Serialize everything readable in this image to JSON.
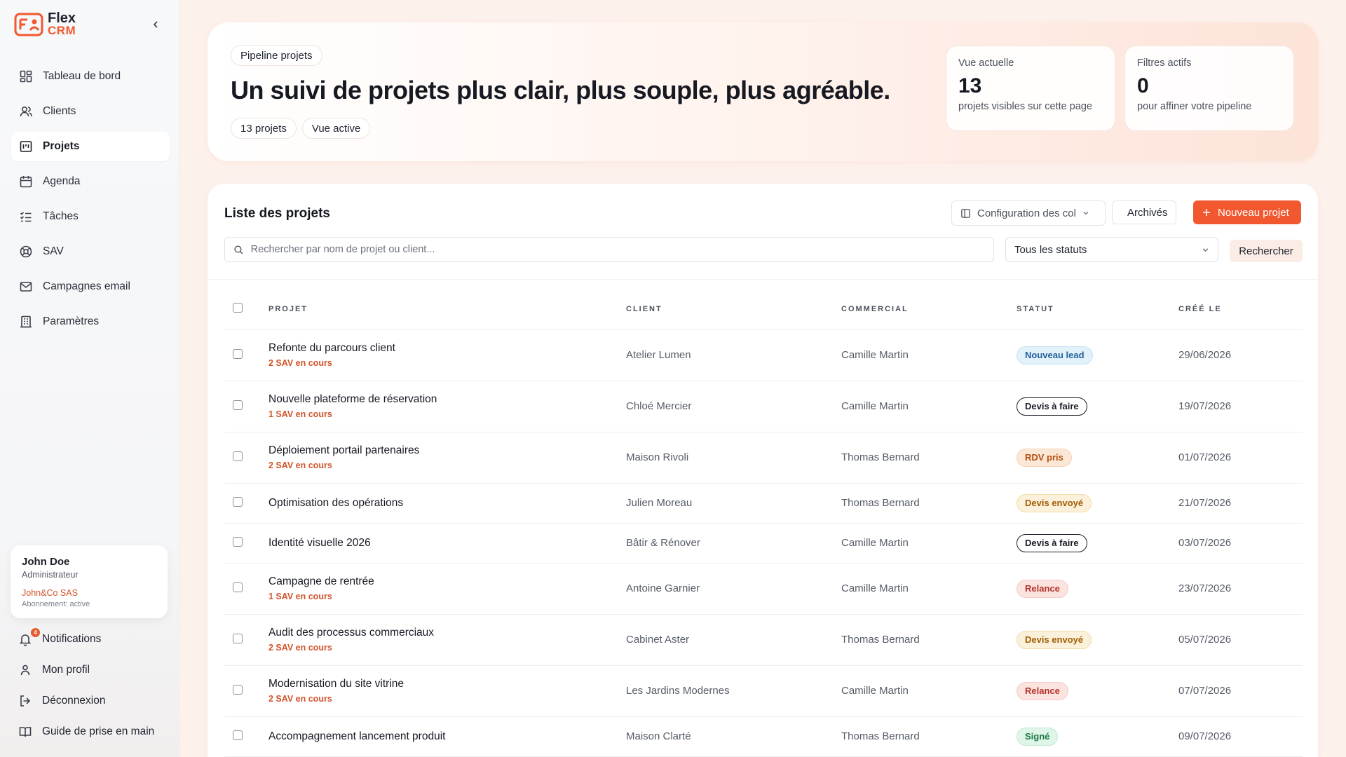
{
  "app": {
    "logo_line1": "Flex",
    "logo_line2": "CRM"
  },
  "sidebar": {
    "items": [
      {
        "label": "Tableau de bord",
        "icon": "dashboard-icon"
      },
      {
        "label": "Clients",
        "icon": "users-icon"
      },
      {
        "label": "Projets",
        "icon": "projects-icon",
        "active": true
      },
      {
        "label": "Agenda",
        "icon": "calendar-icon"
      },
      {
        "label": "Tâches",
        "icon": "tasks-icon"
      },
      {
        "label": "SAV",
        "icon": "support-icon"
      },
      {
        "label": "Campagnes email",
        "icon": "mail-icon"
      },
      {
        "label": "Paramètres",
        "icon": "settings-icon"
      }
    ],
    "user": {
      "name": "John Doe",
      "role": "Administrateur",
      "company": "John&Co SAS",
      "subscription": "Abonnement: active"
    },
    "bottom": {
      "notifications": "Notifications",
      "notifications_count": "4",
      "profile": "Mon profil",
      "logout": "Déconnexion",
      "guide": "Guide de prise en main"
    }
  },
  "hero": {
    "tag": "Pipeline projets",
    "title": "Un suivi de projets plus clair, plus souple, plus agréable.",
    "pill_count": "13 projets",
    "pill_view": "Vue active",
    "stats": [
      {
        "label": "Vue actuelle",
        "value": "13",
        "desc": "projets visibles sur cette page"
      },
      {
        "label": "Filtres actifs",
        "value": "0",
        "desc": "pour affiner votre pipeline"
      }
    ]
  },
  "list": {
    "title": "Liste des projets",
    "config_label": "Configuration des col",
    "archive_label": "Archivés",
    "new_label": "Nouveau projet",
    "search_placeholder": "Rechercher par nom de projet ou client...",
    "status_filter": "Tous les statuts",
    "search_button": "Rechercher",
    "columns": {
      "project": "PROJET",
      "client": "CLIENT",
      "commercial": "COMMERCIAL",
      "status": "STATUT",
      "created": "CRÉÉ LE"
    },
    "rows": [
      {
        "project": "Refonte du parcours client",
        "sav": "2 SAV en cours",
        "client": "Atelier Lumen",
        "commercial": "Camille Martin",
        "status": "Nouveau lead",
        "status_kind": "lead",
        "created": "29/06/2026"
      },
      {
        "project": "Nouvelle plateforme de réservation",
        "sav": "1 SAV en cours",
        "client": "Chloé Mercier",
        "commercial": "Camille Martin",
        "status": "Devis à faire",
        "status_kind": "devis",
        "created": "19/07/2026"
      },
      {
        "project": "Déploiement portail partenaires",
        "sav": "2 SAV en cours",
        "client": "Maison Rivoli",
        "commercial": "Thomas Bernard",
        "status": "RDV pris",
        "status_kind": "rdv",
        "created": "01/07/2026"
      },
      {
        "project": "Optimisation des opérations",
        "sav": "",
        "client": "Julien Moreau",
        "commercial": "Thomas Bernard",
        "status": "Devis envoyé",
        "status_kind": "envoye",
        "created": "21/07/2026"
      },
      {
        "project": "Identité visuelle 2026",
        "sav": "",
        "client": "Bâtir & Rénover",
        "commercial": "Camille Martin",
        "status": "Devis à faire",
        "status_kind": "devis",
        "created": "03/07/2026"
      },
      {
        "project": "Campagne de rentrée",
        "sav": "1 SAV en cours",
        "client": "Antoine Garnier",
        "commercial": "Camille Martin",
        "status": "Relance",
        "status_kind": "relance",
        "created": "23/07/2026"
      },
      {
        "project": "Audit des processus commerciaux",
        "sav": "2 SAV en cours",
        "client": "Cabinet Aster",
        "commercial": "Thomas Bernard",
        "status": "Devis envoyé",
        "status_kind": "envoye",
        "created": "05/07/2026"
      },
      {
        "project": "Modernisation du site vitrine",
        "sav": "2 SAV en cours",
        "client": "Les Jardins Modernes",
        "commercial": "Camille Martin",
        "status": "Relance",
        "status_kind": "relance",
        "created": "07/07/2026"
      },
      {
        "project": "Accompagnement lancement produit",
        "sav": "",
        "client": "Maison Clarté",
        "commercial": "Thomas Bernard",
        "status": "Signé",
        "status_kind": "signe",
        "created": "09/07/2026"
      }
    ]
  },
  "colors": {
    "accent": "#f2582f",
    "text": "#161922",
    "sav": "#d2542b"
  }
}
